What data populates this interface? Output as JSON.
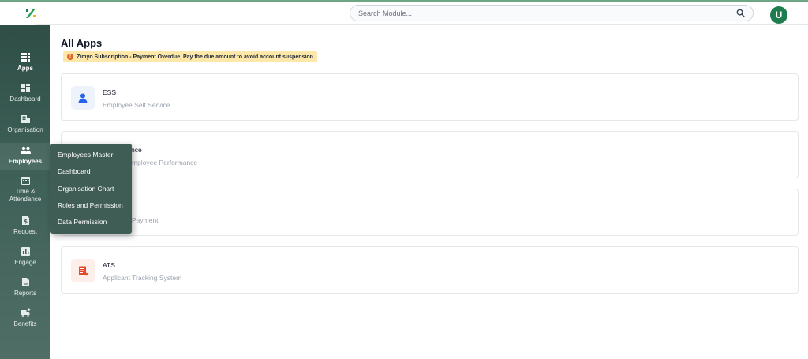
{
  "header": {
    "search_placeholder": "Search Module...",
    "avatar_initial": "U"
  },
  "sidebar": {
    "items": [
      {
        "label": "Apps",
        "icon": "grid-icon"
      },
      {
        "label": "Dashboard",
        "icon": "dashboard-icon"
      },
      {
        "label": "Organisation",
        "icon": "building-icon"
      },
      {
        "label": "Employees",
        "icon": "people-icon"
      },
      {
        "label_line1": "Time &",
        "label_line2": "Attendance",
        "icon": "calendar-icon"
      },
      {
        "label": "Request",
        "icon": "dollar-doc-icon"
      },
      {
        "label": "Engage",
        "icon": "bar-chart-icon"
      },
      {
        "label": "Reports",
        "icon": "document-icon"
      },
      {
        "label": "Benefits",
        "icon": "truck-plus-icon"
      }
    ]
  },
  "main": {
    "title": "All Apps",
    "alert": "Zimyo Subscription - Payment Overdue, Pay the due amount to avoid account suspension"
  },
  "cards": [
    {
      "title": "ESS",
      "subtitle": "Employee Self Service"
    },
    {
      "title": "nce",
      "subtitle": "mployee Performance"
    },
    {
      "title": "",
      "subtitle": "Payment"
    },
    {
      "title": "ATS",
      "subtitle": "Applicant Tracking System"
    }
  ],
  "flyout": {
    "items": [
      "Employees Master",
      "Dashboard",
      "Organisation Chart",
      "Roles and Permission",
      "Data Permission"
    ]
  },
  "colors": {
    "sidebar": "#3d5f56",
    "accent": "#1e7d4f",
    "alert_bg": "#fde7a9",
    "alert_icon": "#e0672a"
  }
}
